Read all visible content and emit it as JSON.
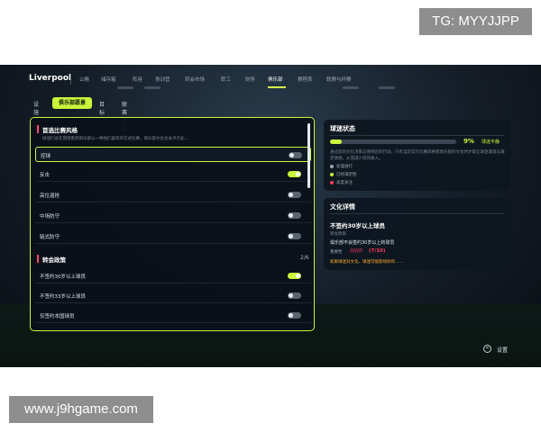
{
  "watermarks": {
    "top": "TG: MYYJJPP",
    "bottom": "www.j9hgame.com"
  },
  "header": {
    "club": "Liverpool",
    "tabs": [
      {
        "label": "公略"
      },
      {
        "label": "储存箱"
      },
      {
        "label": "阵容"
      },
      {
        "label": "青训营"
      },
      {
        "label": "转会市场"
      },
      {
        "label": "职工"
      },
      {
        "label": "财务"
      },
      {
        "label": "俱乐部",
        "active": true
      },
      {
        "label": "赛程表"
      },
      {
        "label": "联赛与杯赛"
      }
    ]
  },
  "subnav": {
    "items": [
      {
        "label": "设施"
      },
      {
        "label": "俱乐部愿景",
        "active": true
      },
      {
        "label": "目标"
      },
      {
        "label": "联赛大会"
      }
    ]
  },
  "left": {
    "section1": {
      "title": "首选比赛风格",
      "desc": "球迷们总在期望看到俱乐部以一种他们喜欢的方式比赛，俱乐部文化也关乎于此..."
    },
    "style_rows": [
      {
        "label": "控球",
        "on": false,
        "selected": true
      },
      {
        "label": "反击",
        "on": true
      },
      {
        "label": "高位逼抢",
        "on": false
      },
      {
        "label": "中场防守",
        "on": false
      },
      {
        "label": "链式防守",
        "on": false
      }
    ],
    "section2": {
      "title": "转会政策",
      "count": "2/6"
    },
    "transfer_rows": [
      {
        "label": "不签约30岁以上球员",
        "on": true
      },
      {
        "label": "不签约33岁以上球员",
        "on": false
      },
      {
        "label": "仅签约本国球员",
        "on": false
      }
    ]
  },
  "fan_status": {
    "title": "球迷状态",
    "value_pct": 9,
    "value_label": "9%",
    "status": "球迷平静",
    "desc": "通过您的文化决策与保持您的行动，只有当您实行比赛风格或俱乐部的文化时才能让球迷满意与满足情感，从而减少您的收入。",
    "legend": [
      {
        "label": "处理进行",
        "color": "#9aa5b1"
      },
      {
        "label": "已经满足性",
        "color": "#c9f53b"
      },
      {
        "label": "高度关注",
        "color": "#ff3b5c"
      }
    ]
  },
  "culture": {
    "title": "文化详情",
    "name": "不签约30岁以上球员",
    "category": "转会政策",
    "detail": "俱乐部不会签约30岁以上的球员",
    "importance_label": "重要性",
    "slashes": "///////",
    "rating": "(7/10)",
    "warning": "如果球迷对文化、球迷可能影响你的……"
  },
  "footer": {
    "settings_icon": "circle-x-icon",
    "settings_label": "设置"
  }
}
